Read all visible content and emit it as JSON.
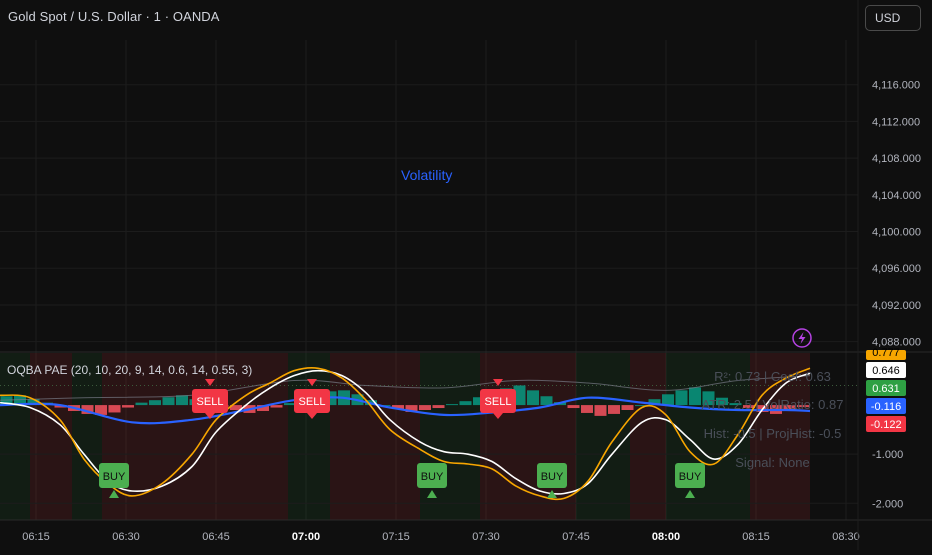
{
  "header": {
    "symbol_title": "Gold Spot / U.S. Dollar · 1 · OANDA",
    "currency_button": "USD",
    "volatility_label": "Volatility"
  },
  "indicator": {
    "title": "OQBA PAE (20, 10, 20, 9, 14, 0.6, 14, 0.55, 3)",
    "stats": [
      "R²: 0.73 | Coef: 0.63",
      "ATR: 2.5 | VolRatio: 0.87",
      "Hist: -0.5 | ProjHist: -0.5",
      "Signal: None"
    ],
    "value_badges": [
      {
        "text": "0.777",
        "color": "#f7a600",
        "text_color": "#000000"
      },
      {
        "text": "0.646",
        "color": "#ffffff",
        "text_color": "#000000"
      },
      {
        "text": "0.631",
        "color": "#2ea043",
        "text_color": "#ffffff"
      },
      {
        "text": "-0.116",
        "color": "#2962ff",
        "text_color": "#ffffff"
      },
      {
        "text": "-0.122",
        "color": "#f23645",
        "text_color": "#ffffff"
      }
    ]
  },
  "price_axis": {
    "ticks": [
      "4,116.000",
      "4,112.000",
      "4,108.000",
      "4,104.000",
      "4,100.000",
      "4,096.000",
      "4,092.000",
      "4,088.000"
    ]
  },
  "time_axis": {
    "ticks": [
      {
        "label": "06:15",
        "bold": false
      },
      {
        "label": "06:30",
        "bold": false
      },
      {
        "label": "06:45",
        "bold": false
      },
      {
        "label": "07:00",
        "bold": true
      },
      {
        "label": "07:15",
        "bold": false
      },
      {
        "label": "07:30",
        "bold": false
      },
      {
        "label": "07:45",
        "bold": false
      },
      {
        "label": "08:00",
        "bold": true
      },
      {
        "label": "08:15",
        "bold": false
      },
      {
        "label": "08:30",
        "bold": false
      }
    ]
  },
  "colors": {
    "background": "#0f0f0f",
    "orange": "#f7a600",
    "white": "#ffffff",
    "blue": "#2962ff",
    "green": "#2ea043",
    "red": "#f23645",
    "teal": "#089981",
    "pink": "#f7525f"
  },
  "chart_data": {
    "type": "line",
    "title": "",
    "xlabel": "",
    "ylabel": "",
    "x_range": [
      "06:09",
      "08:32"
    ],
    "price_ylim": [
      4086,
      4120
    ],
    "indicator_ylim": [
      -2.3,
      1.0
    ],
    "indicator_ticks": [
      -1.0,
      -2.0
    ],
    "series": [
      {
        "color": "#f7a600",
        "x": [
          "06:09",
          "06:14",
          "06:19",
          "06:23",
          "06:27",
          "06:31",
          "06:36",
          "06:41",
          "06:45",
          "06:50",
          "06:54",
          "06:58",
          "07:02",
          "07:06",
          "07:10",
          "07:14",
          "07:19",
          "07:23",
          "07:27",
          "07:31",
          "07:35",
          "07:39",
          "07:43",
          "07:47",
          "07:51",
          "07:56",
          "08:00",
          "08:04",
          "08:08",
          "08:12",
          "08:16",
          "08:20",
          "08:24"
        ],
        "values": [
          0.2,
          0.15,
          -0.3,
          -1.1,
          -1.6,
          -1.85,
          -1.6,
          -1.0,
          -0.3,
          0.2,
          0.45,
          0.7,
          0.75,
          0.55,
          0.1,
          -0.5,
          -0.9,
          -1.15,
          -1.2,
          -1.3,
          -1.65,
          -1.85,
          -1.9,
          -1.55,
          -0.75,
          -0.05,
          -0.2,
          -0.95,
          -1.2,
          -0.6,
          0.2,
          0.55,
          0.75
        ]
      },
      {
        "color": "#ffffff",
        "x": [
          "06:09",
          "06:14",
          "06:19",
          "06:23",
          "06:27",
          "06:31",
          "06:36",
          "06:41",
          "06:45",
          "06:50",
          "06:54",
          "06:58",
          "07:02",
          "07:06",
          "07:10",
          "07:14",
          "07:19",
          "07:23",
          "07:27",
          "07:31",
          "07:35",
          "07:39",
          "07:43",
          "07:47",
          "07:51",
          "07:56",
          "08:00",
          "08:04",
          "08:08",
          "08:12",
          "08:16",
          "08:20",
          "08:24"
        ],
        "values": [
          0.05,
          -0.05,
          -0.4,
          -1.0,
          -1.55,
          -1.75,
          -1.65,
          -1.25,
          -0.55,
          0.0,
          0.35,
          0.6,
          0.7,
          0.6,
          0.25,
          -0.3,
          -0.75,
          -0.95,
          -1.0,
          -1.15,
          -1.5,
          -1.75,
          -1.8,
          -1.6,
          -1.0,
          -0.35,
          -0.3,
          -0.7,
          -1.1,
          -0.8,
          -0.1,
          0.45,
          0.65
        ]
      },
      {
        "color": "#2962ff",
        "x": [
          "06:09",
          "06:19",
          "06:31",
          "06:41",
          "06:50",
          "06:58",
          "07:06",
          "07:14",
          "07:23",
          "07:31",
          "07:39",
          "07:47",
          "07:56",
          "08:04",
          "08:12",
          "08:20",
          "08:24"
        ],
        "values": [
          0.0,
          0.0,
          -0.35,
          -0.3,
          -0.1,
          0.1,
          0.15,
          -0.05,
          -0.2,
          -0.15,
          -0.05,
          0.15,
          0.05,
          -0.05,
          -0.1,
          -0.1,
          -0.12
        ]
      },
      {
        "color": "#787b86",
        "x": [
          "06:09",
          "06:23",
          "06:41",
          "06:58",
          "07:10",
          "07:23",
          "07:35",
          "07:47",
          "08:00",
          "08:12",
          "08:24"
        ],
        "values": [
          0.1,
          0.15,
          0.2,
          0.5,
          0.4,
          0.35,
          0.5,
          0.45,
          0.3,
          0.5,
          0.6
        ]
      }
    ],
    "histogram": {
      "x_range": [
        "06:09",
        "08:24"
      ],
      "values": [
        0.18,
        0.2,
        0.12,
        0.05,
        -0.05,
        -0.12,
        -0.18,
        -0.2,
        -0.15,
        -0.05,
        0.05,
        0.1,
        0.16,
        0.2,
        0.12,
        0.05,
        -0.04,
        -0.1,
        -0.16,
        -0.12,
        -0.05,
        0.04,
        0.12,
        0.2,
        0.28,
        0.3,
        0.22,
        0.1,
        0.0,
        -0.08,
        -0.14,
        -0.1,
        -0.06,
        0.02,
        0.08,
        0.16,
        0.24,
        0.34,
        0.4,
        0.3,
        0.18,
        0.06,
        -0.06,
        -0.16,
        -0.22,
        -0.18,
        -0.1,
        0.0,
        0.12,
        0.22,
        0.3,
        0.36,
        0.28,
        0.15,
        0.04,
        -0.06,
        -0.14,
        -0.18,
        -0.12,
        -0.04
      ]
    },
    "signals": [
      {
        "label": "SELL",
        "x": "06:44",
        "kind": "sell"
      },
      {
        "label": "BUY",
        "x": "06:28",
        "kind": "buy"
      },
      {
        "label": "SELL",
        "x": "07:01",
        "kind": "sell"
      },
      {
        "label": "BUY",
        "x": "07:21",
        "kind": "buy"
      },
      {
        "label": "SELL",
        "x": "07:32",
        "kind": "sell"
      },
      {
        "label": "BUY",
        "x": "07:41",
        "kind": "buy"
      },
      {
        "label": "BUY",
        "x": "08:04",
        "kind": "buy"
      }
    ],
    "zones": [
      {
        "from": "06:09",
        "to": "06:14",
        "kind": "bull"
      },
      {
        "from": "06:14",
        "to": "06:21",
        "kind": "bear"
      },
      {
        "from": "06:21",
        "to": "06:26",
        "kind": "bull"
      },
      {
        "from": "06:26",
        "to": "06:41",
        "kind": "bear"
      },
      {
        "from": "06:41",
        "to": "06:57",
        "kind": "bear"
      },
      {
        "from": "06:57",
        "to": "07:04",
        "kind": "bull"
      },
      {
        "from": "07:04",
        "to": "07:19",
        "kind": "bear"
      },
      {
        "from": "07:19",
        "to": "07:29",
        "kind": "bull"
      },
      {
        "from": "07:29",
        "to": "07:45",
        "kind": "bear"
      },
      {
        "from": "07:45",
        "to": "07:54",
        "kind": "bull"
      },
      {
        "from": "07:54",
        "to": "08:00",
        "kind": "bear"
      },
      {
        "from": "08:00",
        "to": "08:14",
        "kind": "bull"
      },
      {
        "from": "08:14",
        "to": "08:24",
        "kind": "bear"
      }
    ]
  }
}
